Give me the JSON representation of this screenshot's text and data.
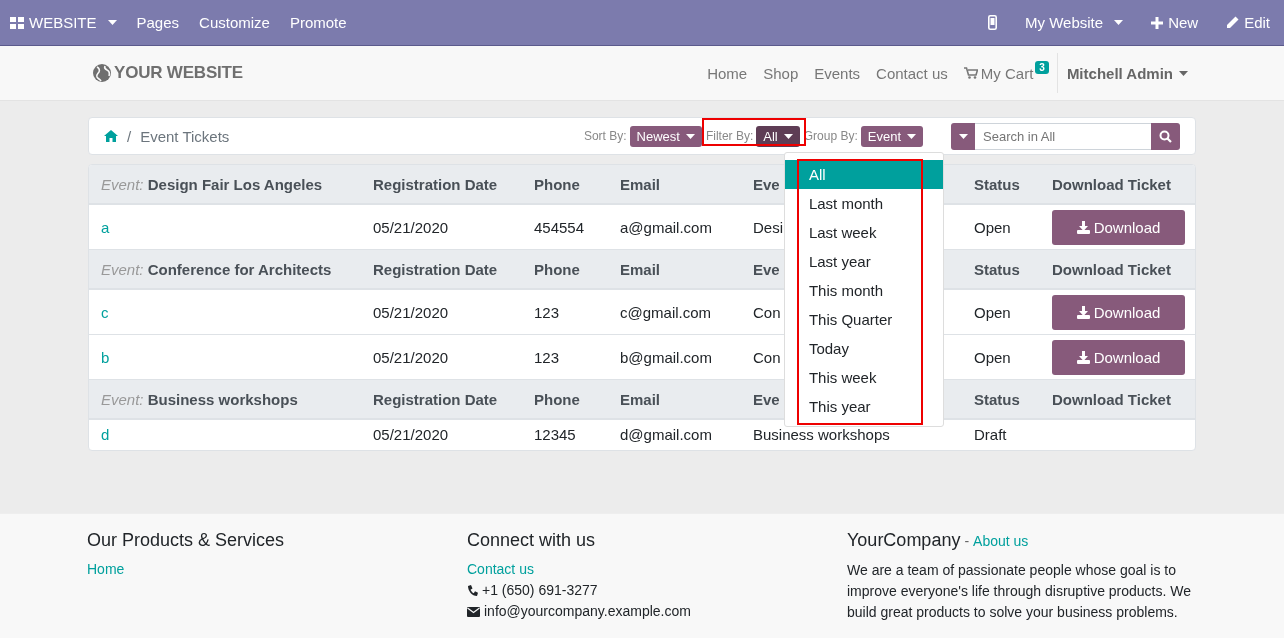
{
  "admin_bar": {
    "app_menu": "WEBSITE",
    "items": [
      "Pages",
      "Customize",
      "Promote"
    ],
    "website_menu": "My Website",
    "new_button": "New",
    "edit_button": "Edit"
  },
  "navbar": {
    "logo": "YOUR WEBSITE",
    "links": [
      "Home",
      "Shop",
      "Events",
      "Contact us"
    ],
    "cart": {
      "label": "My Cart",
      "count": "3"
    },
    "user": "Mitchell Admin"
  },
  "breadcrumb": {
    "separator": "/",
    "current": "Event Tickets"
  },
  "controls": {
    "sort": {
      "label": "Sort By:",
      "value": "Newest"
    },
    "filter": {
      "label": "Filter By:",
      "value": "All",
      "expanded": true
    },
    "group": {
      "label": "Group By:",
      "value": "Event"
    },
    "search": {
      "placeholder": "Search in All"
    }
  },
  "filter_options": [
    {
      "label": "All",
      "selected": true
    },
    {
      "label": "Last month",
      "selected": false
    },
    {
      "label": "Last week",
      "selected": false
    },
    {
      "label": "Last year",
      "selected": false
    },
    {
      "label": "This month",
      "selected": false
    },
    {
      "label": "This Quarter",
      "selected": false
    },
    {
      "label": "Today",
      "selected": false
    },
    {
      "label": "This week",
      "selected": false
    },
    {
      "label": "This year",
      "selected": false
    }
  ],
  "ticket_groups": [
    {
      "event_label": "Event:",
      "event": "Design Fair Los Angeles",
      "headers": [
        "Registration Date",
        "Phone",
        "Email",
        "Eve",
        "Status",
        "Download Ticket"
      ],
      "rows": [
        {
          "name": "a",
          "date": "05/21/2020",
          "phone": "454554",
          "email": "a@gmail.com",
          "event": "Desi",
          "status": "Open",
          "download": "Download"
        }
      ]
    },
    {
      "event_label": "Event:",
      "event": "Conference for Architects",
      "headers": [
        "Registration Date",
        "Phone",
        "Email",
        "Eve",
        "Status",
        "Download Ticket"
      ],
      "rows": [
        {
          "name": "c",
          "date": "05/21/2020",
          "phone": "123",
          "email": "c@gmail.com",
          "event": "Con",
          "status": "Open",
          "download": "Download"
        },
        {
          "name": "b",
          "date": "05/21/2020",
          "phone": "123",
          "email": "b@gmail.com",
          "event": "Con",
          "status": "Open",
          "download": "Download"
        }
      ]
    },
    {
      "event_label": "Event:",
      "event": "Business workshops",
      "headers": [
        "Registration Date",
        "Phone",
        "Email",
        "Eve",
        "Status",
        "Download Ticket"
      ],
      "rows": [
        {
          "name": "d",
          "date": "05/21/2020",
          "phone": "12345",
          "email": "d@gmail.com",
          "event": "Business workshops",
          "status": "Draft"
        }
      ]
    }
  ],
  "footer": {
    "products": {
      "title": "Our Products & Services",
      "links": [
        "Home"
      ]
    },
    "connect": {
      "title": "Connect with us",
      "link": "Contact us",
      "phone": "+1 (650) 691-3277",
      "email": "info@yourcompany.example.com"
    },
    "about": {
      "company": "YourCompany",
      "separator": "-",
      "link": "About us",
      "text": "We are a team of passionate people whose goal is to improve everyone's life through disruptive products. We build great products to solve your business problems."
    }
  }
}
